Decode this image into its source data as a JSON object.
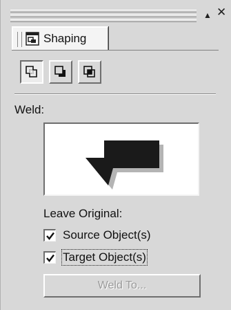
{
  "docker": {
    "title_controls": {
      "collapse_glyph": "▲",
      "close_glyph": "✕"
    },
    "tab": {
      "label": "Shaping",
      "icon": "shaping-docker-icon"
    },
    "tools": [
      {
        "name": "weld",
        "icon": "weld-icon",
        "pressed": true
      },
      {
        "name": "trim",
        "icon": "trim-icon",
        "pressed": false
      },
      {
        "name": "intersect",
        "icon": "intersect-icon",
        "pressed": false
      }
    ],
    "section_label": "Weld:",
    "preview": {
      "icon": "weld-preview-shape"
    },
    "leave_original_label": "Leave Original:",
    "source_object": {
      "label": "Source Object(s)",
      "checked": true
    },
    "target_object": {
      "label": "Target Object(s)",
      "checked": true
    },
    "weld_to_button": {
      "label": "Weld To...",
      "enabled": false
    }
  },
  "colors": {
    "panel_bg": "#d8d8d8",
    "shape_fill": "#1a1a1a",
    "shape_shadow": "#b4b4b4",
    "disabled_text": "#9a9a9a"
  }
}
